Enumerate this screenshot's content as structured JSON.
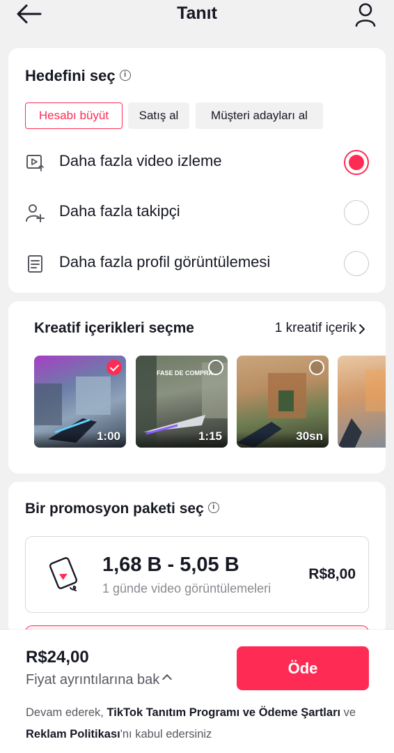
{
  "header": {
    "title": "Tanıt"
  },
  "goal": {
    "title": "Hedefini seç",
    "chips": [
      "Hesabı büyüt",
      "Satış al",
      "Müşteri adayları al"
    ],
    "active_chip": 0,
    "options": [
      {
        "label": "Daha fazla video izleme",
        "icon": "video-play-icon",
        "selected": true
      },
      {
        "label": "Daha fazla takipçi",
        "icon": "add-person-icon",
        "selected": false
      },
      {
        "label": "Daha fazla profil görüntülemesi",
        "icon": "document-icon",
        "selected": false
      }
    ]
  },
  "creative": {
    "title": "Kreatif içerikleri seçme",
    "link": "1 kreatif içerik",
    "thumbs": [
      {
        "duration": "1:00",
        "selected": true
      },
      {
        "duration": "1:15",
        "selected": false,
        "overlay": "FASE DE COMPRA"
      },
      {
        "duration": "30sn",
        "selected": false
      },
      {
        "duration": "",
        "selected": false
      }
    ]
  },
  "package": {
    "title": "Bir promosyon paketi seç",
    "range": "1,68 B - 5,05 B",
    "subtitle": "1 günde video görüntülemeleri",
    "price": "R$8,00"
  },
  "footer": {
    "total": "R$24,00",
    "details": "Fiyat ayrıntılarına bak",
    "pay_label": "Öde",
    "terms_prefix": "Devam ederek, ",
    "terms_link1": "TikTok Tanıtım Programı ve Ödeme Şartları",
    "terms_mid": " ve ",
    "terms_link2": "Reklam Politikası",
    "terms_suffix": "'nı kabul edersiniz"
  },
  "colors": {
    "accent": "#fe2c55",
    "text": "#161823",
    "muted": "#8a8b91",
    "background": "#f1f1f2"
  }
}
